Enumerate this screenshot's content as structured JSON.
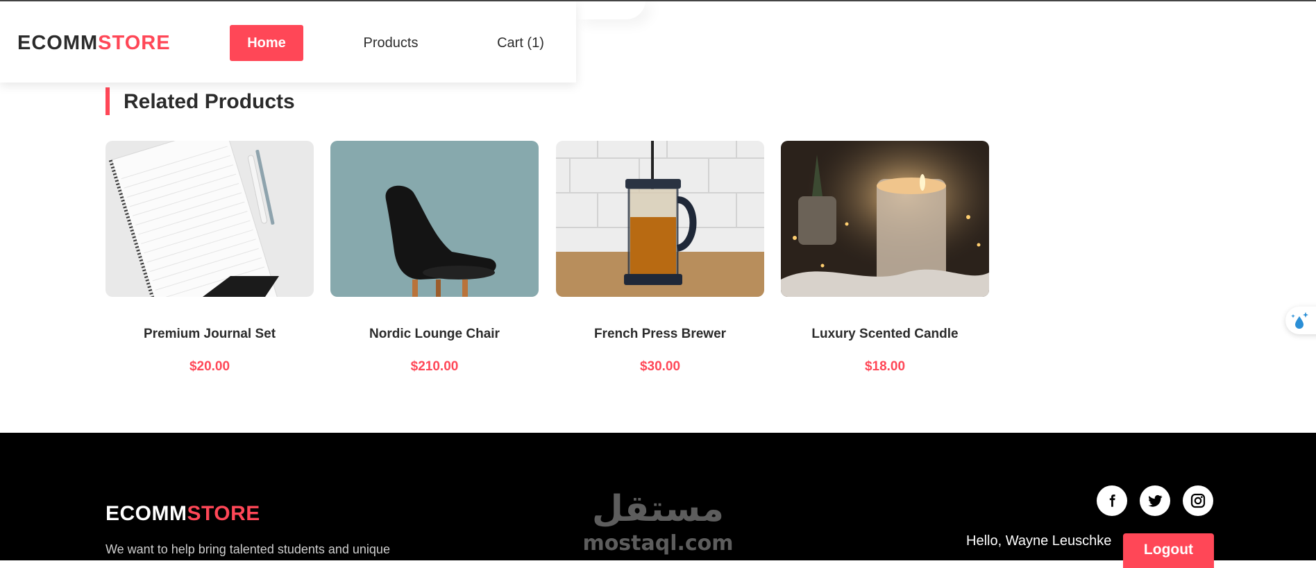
{
  "header": {
    "logo_part1": "ECOMM",
    "logo_part2": "STORE",
    "nav": {
      "home": "Home",
      "products": "Products",
      "cart": "Cart (1)"
    },
    "active_item": "Home"
  },
  "related": {
    "title": "Related Products",
    "products": [
      {
        "name": "Premium Journal Set",
        "price": "$20.00",
        "image": "journal-notebook-image"
      },
      {
        "name": "Nordic Lounge Chair",
        "price": "$210.00",
        "image": "black-chair-image"
      },
      {
        "name": "French Press Brewer",
        "price": "$30.00",
        "image": "french-press-image"
      },
      {
        "name": "Luxury Scented Candle",
        "price": "$18.00",
        "image": "scented-candle-image"
      }
    ]
  },
  "footer": {
    "logo_part1": "ECOMM",
    "logo_part2": "STORE",
    "description": "We want to help bring talented students and unique",
    "watermark_arabic": "مستقل",
    "watermark_latin": "mostaql.com",
    "greeting": "Hello, Wayne Leuschke",
    "logout_label": "Logout",
    "social": [
      "facebook-icon",
      "twitter-icon",
      "instagram-icon"
    ]
  },
  "colors": {
    "accent": "#ff4757",
    "dark_text": "#2b2b2b",
    "footer_bg": "#000000"
  }
}
